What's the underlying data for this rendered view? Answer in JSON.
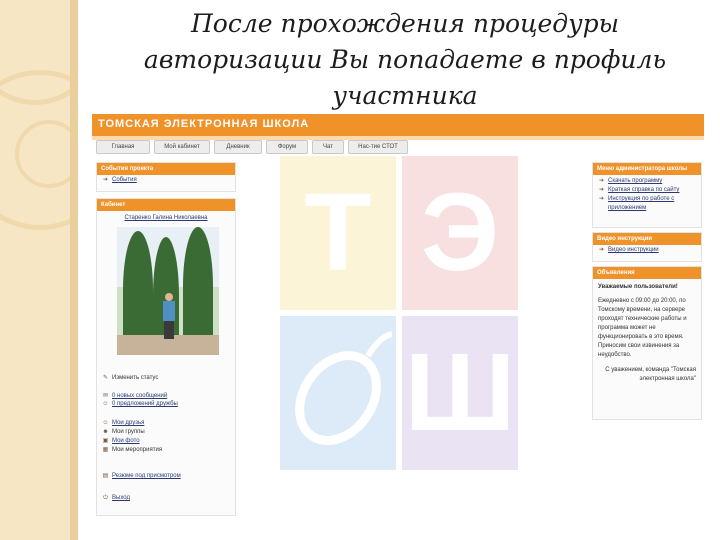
{
  "slide": {
    "title_lines": [
      "После прохождения процедуры",
      "авторизации Вы попадаете в профиль",
      "участника"
    ]
  },
  "site": {
    "brand": "ТОМСКАЯ ЭЛЕКТРОННАЯ ШКОЛА",
    "brand_color": "#f0922a",
    "nav": [
      "Главная",
      "Мой кабинет",
      "Дневник",
      "Форум",
      "Чат",
      "Нас-тие СТОТ"
    ],
    "watermark_letters": [
      "Т",
      "Э",
      "",
      "Ш"
    ],
    "events_box": {
      "title": "События проекта",
      "items": [
        {
          "icon": "arrow-icon",
          "label": "События"
        }
      ]
    },
    "cabinet_box": {
      "title": "Кабинет",
      "user_name": "Старенко Галина Николаевна",
      "status_link": "Изменить статус",
      "message_links": [
        "0 новых сообщений",
        "0 предложений дружбы"
      ],
      "section_links": [
        "Мои друзья",
        "Мои группы",
        "Мои фото",
        "Мои мероприятия"
      ],
      "resume_link": "Резюме под присмотром",
      "logout_link": "Выход"
    },
    "admin_box": {
      "title": "Меню администратора школы",
      "items": [
        "Скачать программу",
        "Краткая справка по сайту",
        "Инструкция по работе с",
        "приложением"
      ]
    },
    "video_box": {
      "title": "Видео инструкции",
      "items": [
        "Видео инструкции"
      ]
    },
    "announce_box": {
      "title": "Объявления",
      "heading": "Уважаемые пользователи!",
      "lines": [
        "Ежедневно с 09:00 до 20:00, по",
        "Томскому времени, на сервере",
        "проходят технические работы и",
        "программа может не",
        "функционировать в это время.",
        "Приносим свои извинения за",
        "неудобство."
      ],
      "signature": [
        "С уважением, команда \"Томская",
        "электронная школа\""
      ]
    }
  }
}
